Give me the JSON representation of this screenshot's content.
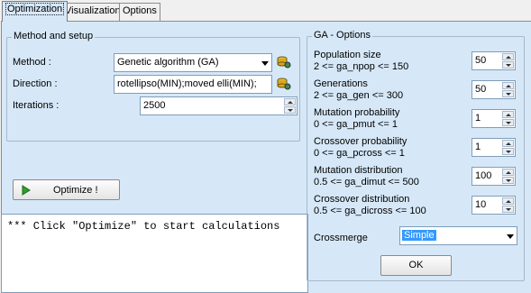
{
  "tabs": [
    "Optimization",
    "Visualization",
    "Options"
  ],
  "method_group": {
    "title": "Method and setup",
    "method_label": "Method :",
    "method_value": "Genetic algorithm (GA)",
    "direction_label": "Direction :",
    "direction_value": "rotellipso(MIN);moved elli(MIN);",
    "iterations_label": "Iterations :",
    "iterations_value": "2500"
  },
  "optimize_button": "Optimize !",
  "output_text": "*** Click \"Optimize\" to start calculations",
  "ga_options": {
    "title": "GA - Options",
    "params": [
      {
        "name": "Population size",
        "range": "2 <= ga_npop <= 150",
        "value": "50"
      },
      {
        "name": "Generations",
        "range": "2 <= ga_gen <= 300",
        "value": "50"
      },
      {
        "name": "Mutation probability",
        "range": "0 <= ga_pmut <= 1",
        "value": "1"
      },
      {
        "name": "Crossover probability",
        "range": "0 <= ga_pcross <= 1",
        "value": "1"
      },
      {
        "name": "Mutation distribution",
        "range": "0.5 <= ga_dimut <= 500",
        "value": "100"
      },
      {
        "name": "Crossover distribution",
        "range": "0.5 <= ga_dicross <= 100",
        "value": "10"
      }
    ],
    "crossmerge_label": "Crossmerge",
    "crossmerge_value": "Simple",
    "ok_label": "OK"
  },
  "colors": {
    "panel": "#d6e8f8",
    "selection": "#3399ff",
    "play_icon": "#2ca02c"
  }
}
